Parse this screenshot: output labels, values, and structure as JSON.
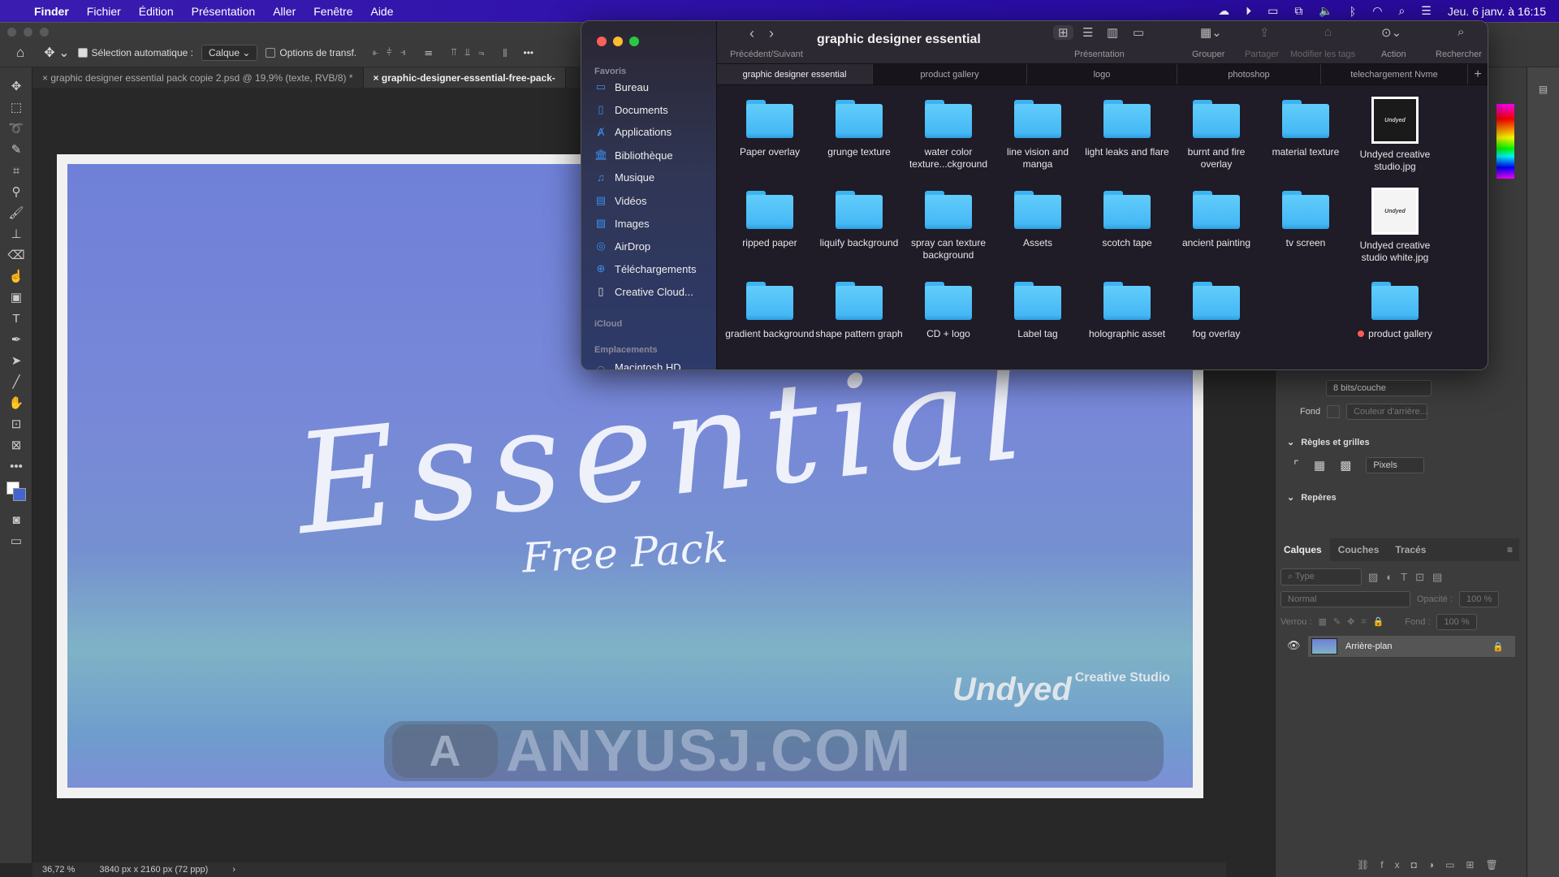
{
  "menubar": {
    "app": "Finder",
    "items": [
      "Fichier",
      "Édition",
      "Présentation",
      "Aller",
      "Fenêtre",
      "Aide"
    ],
    "clock": "Jeu. 6 janv. à  16:15"
  },
  "options_bar": {
    "auto_select_label": "Sélection automatique :",
    "auto_select_value": "Calque",
    "transform_label": "Options de transf."
  },
  "doc_tabs": [
    "graphic designer essential pack copie 2.psd @ 19,9% (texte, RVB/8) *",
    "graphic-designer-essential-free-pack-"
  ],
  "canvas": {
    "title": "Essential",
    "subtitle": "Free Pack",
    "brand": "Undyed",
    "brand_small": "Creative Studio",
    "watermark": "ANYUSJ.COM"
  },
  "status": {
    "zoom": "36,72 %",
    "size": "3840 px x 2160 px (72 ppp)"
  },
  "properties": {
    "depth": "8 bits/couche",
    "fond_label": "Fond",
    "fond_value": "Couleur d'arrière...",
    "rulers_section": "Règles et grilles",
    "units": "Pixels",
    "guides_section": "Repères"
  },
  "layers": {
    "tabs": [
      "Calques",
      "Couches",
      "Tracés"
    ],
    "filter_placeholder": "Type",
    "blend": "Normal",
    "opacity_label": "Opacité :",
    "opacity": "100 %",
    "lock_label": "Verrou :",
    "fill_label": "Fond :",
    "fill": "100 %",
    "layer_name": "Arrière-plan"
  },
  "finder": {
    "title": "graphic designer essential",
    "nav_label": "Précédent/Suivant",
    "toolbar": {
      "view": "Présentation",
      "group": "Grouper",
      "share": "Partager",
      "tags": "Modifier les tags",
      "action": "Action",
      "search": "Rechercher"
    },
    "sidebar": {
      "favorites_header": "Favoris",
      "favorites": [
        {
          "label": "Bureau",
          "icon": "desktop-icon"
        },
        {
          "label": "Documents",
          "icon": "document-icon"
        },
        {
          "label": "Applications",
          "icon": "applications-icon"
        },
        {
          "label": "Bibliothèque",
          "icon": "library-icon"
        },
        {
          "label": "Musique",
          "icon": "music-icon"
        },
        {
          "label": "Vidéos",
          "icon": "video-icon"
        },
        {
          "label": "Images",
          "icon": "images-icon"
        },
        {
          "label": "AirDrop",
          "icon": "airdrop-icon"
        },
        {
          "label": "Téléchargements",
          "icon": "downloads-icon"
        },
        {
          "label": "Creative Cloud...",
          "icon": "file-icon"
        }
      ],
      "icloud_header": "iCloud",
      "locations_header": "Emplacements",
      "locations": [
        "Macintosh HD"
      ]
    },
    "tabs": [
      "graphic designer essential",
      "product gallery",
      "logo",
      "photoshop",
      "telechargement Nvme"
    ],
    "items": [
      {
        "name": "Paper overlay",
        "type": "folder"
      },
      {
        "name": "grunge texture",
        "type": "folder"
      },
      {
        "name": "water color texture...ckground",
        "type": "folder"
      },
      {
        "name": "line vision and manga",
        "type": "folder"
      },
      {
        "name": "light leaks and flare",
        "type": "folder"
      },
      {
        "name": "burnt and fire overlay",
        "type": "folder"
      },
      {
        "name": "material texture",
        "type": "folder"
      },
      {
        "name": "Undyed creative studio.jpg",
        "type": "image-dark"
      },
      {
        "name": "ripped paper",
        "type": "folder"
      },
      {
        "name": "liquify background",
        "type": "folder"
      },
      {
        "name": "spray can texture background",
        "type": "folder"
      },
      {
        "name": "Assets",
        "type": "folder"
      },
      {
        "name": "scotch tape",
        "type": "folder"
      },
      {
        "name": "ancient painting",
        "type": "folder"
      },
      {
        "name": "tv screen",
        "type": "folder"
      },
      {
        "name": "Undyed creative studio white.jpg",
        "type": "image-light"
      },
      {
        "name": "gradient background",
        "type": "folder"
      },
      {
        "name": "shape pattern graph",
        "type": "folder"
      },
      {
        "name": "CD + logo",
        "type": "folder"
      },
      {
        "name": "Label tag",
        "type": "folder"
      },
      {
        "name": "holographic asset",
        "type": "folder"
      },
      {
        "name": "fog overlay",
        "type": "folder"
      },
      {
        "name": "",
        "type": "empty"
      },
      {
        "name": "product gallery",
        "type": "folder",
        "tag": "#ff5b50"
      }
    ],
    "thumb_text": "Undyed"
  },
  "colors": {
    "menubar": "#2a0ea8",
    "folder": "#4fc0f8",
    "accent": "#3b8eef",
    "tag_red": "#ff5b50"
  }
}
